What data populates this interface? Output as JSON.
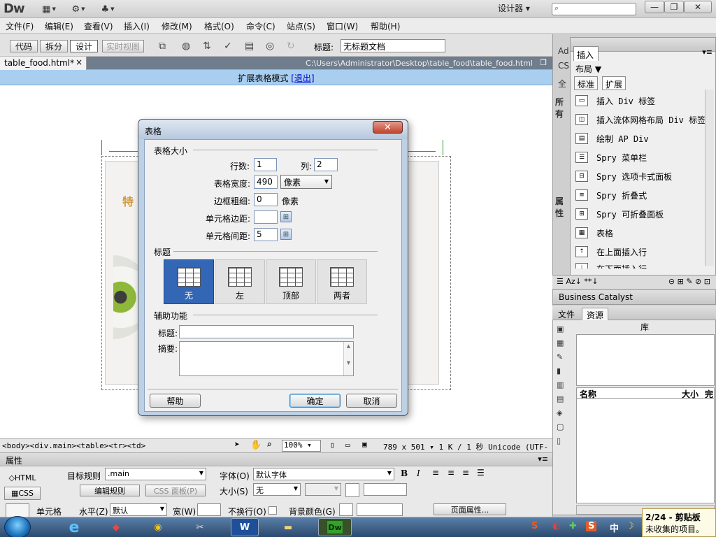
{
  "app": {
    "logo": "Dw",
    "workspace": "设计器"
  },
  "menu": [
    "文件(F)",
    "编辑(E)",
    "查看(V)",
    "插入(I)",
    "修改(M)",
    "格式(O)",
    "命令(C)",
    "站点(S)",
    "窗口(W)",
    "帮助(H)"
  ],
  "doc_toolbar": {
    "code": "代码",
    "split": "拆分",
    "design": "设计",
    "live": "实时视图",
    "title_label": "标题:",
    "title_value": "无标题文档"
  },
  "file_tab": {
    "name": "table_food.html*",
    "close": "×",
    "path": "C:\\Users\\Administrator\\Desktop\\table_food\\table_food.html"
  },
  "expand_bar": {
    "text": "扩展表格模式",
    "exit": "[退出]"
  },
  "status": {
    "tags": "<body><div.main><table><tr><td>",
    "zoom": "100%",
    "info": "789 x 501 ▾ 1 K / 1 秒 Unicode (UTF-8)"
  },
  "properties": {
    "header": "属性",
    "html_btn": "HTML",
    "css_btn": "CSS",
    "target_rule_label": "目标规则",
    "target_rule": ".main",
    "edit_rule": "编辑规则",
    "css_panel": "CSS 面板(P)",
    "font_label": "字体(O)",
    "font_value": "默认字体",
    "size_label": "大小(S)",
    "size_value": "无",
    "cell_label": "单元格",
    "horiz_label": "水平(Z)",
    "horiz_value": "默认",
    "width_label": "宽(W)",
    "nowrap_label": "不换行(O)",
    "bg_label": "背景颜色(G)",
    "page_props": "页面属性..."
  },
  "insert_panel": {
    "tab": "插入",
    "layout": "布局 ▼",
    "subtabs": [
      "标准",
      "扩展"
    ],
    "items": [
      {
        "label": "插入 Div 标签",
        "icon": "div-icon"
      },
      {
        "label": "插入流体网格布局 Div 标签",
        "icon": "fluid-grid-icon"
      },
      {
        "label": "绘制 AP Div",
        "icon": "ap-div-icon"
      },
      {
        "label": "Spry 菜单栏",
        "icon": "spry-menu-icon"
      },
      {
        "label": "Spry 选项卡式面板",
        "icon": "spry-tabs-icon"
      },
      {
        "label": "Spry 折叠式",
        "icon": "spry-accordion-icon"
      },
      {
        "label": "Spry 可折叠面板",
        "icon": "spry-collapsible-icon"
      },
      {
        "label": "表格",
        "icon": "table-icon"
      },
      {
        "label": "在上面插入行",
        "icon": "insert-row-above-icon"
      },
      {
        "label": "在下面插入行",
        "icon": "insert-row-below-icon"
      }
    ],
    "side_labels": [
      "Ad",
      "CS",
      "全",
      "所有",
      "属性"
    ]
  },
  "business_catalyst": "Business Catalyst",
  "assets": {
    "tabs": [
      "文件",
      "资源"
    ],
    "library": "库",
    "col_name": "名称",
    "col_size": "大小",
    "col_full": "完"
  },
  "dialog": {
    "title": "表格",
    "sec_size": "表格大小",
    "rows_label": "行数:",
    "rows": "1",
    "cols_label": "列:",
    "cols": "2",
    "width_label": "表格宽度:",
    "width": "490",
    "unit": "像素",
    "border_label": "边框粗细:",
    "border": "0",
    "border_unit": "像素",
    "padding_label": "单元格边距:",
    "padding": "",
    "spacing_label": "单元格间距:",
    "spacing": "5",
    "sec_header": "标题",
    "header_opts": [
      "无",
      "左",
      "顶部",
      "两者"
    ],
    "sec_access": "辅助功能",
    "caption_label": "标题:",
    "summary_label": "摘要:",
    "help": "帮助",
    "ok": "确定",
    "cancel": "取消"
  },
  "clipboard": {
    "count": "2/24 - 剪贴板",
    "msg": "未收集的项目。"
  },
  "taskbar": {
    "ime": "中"
  }
}
